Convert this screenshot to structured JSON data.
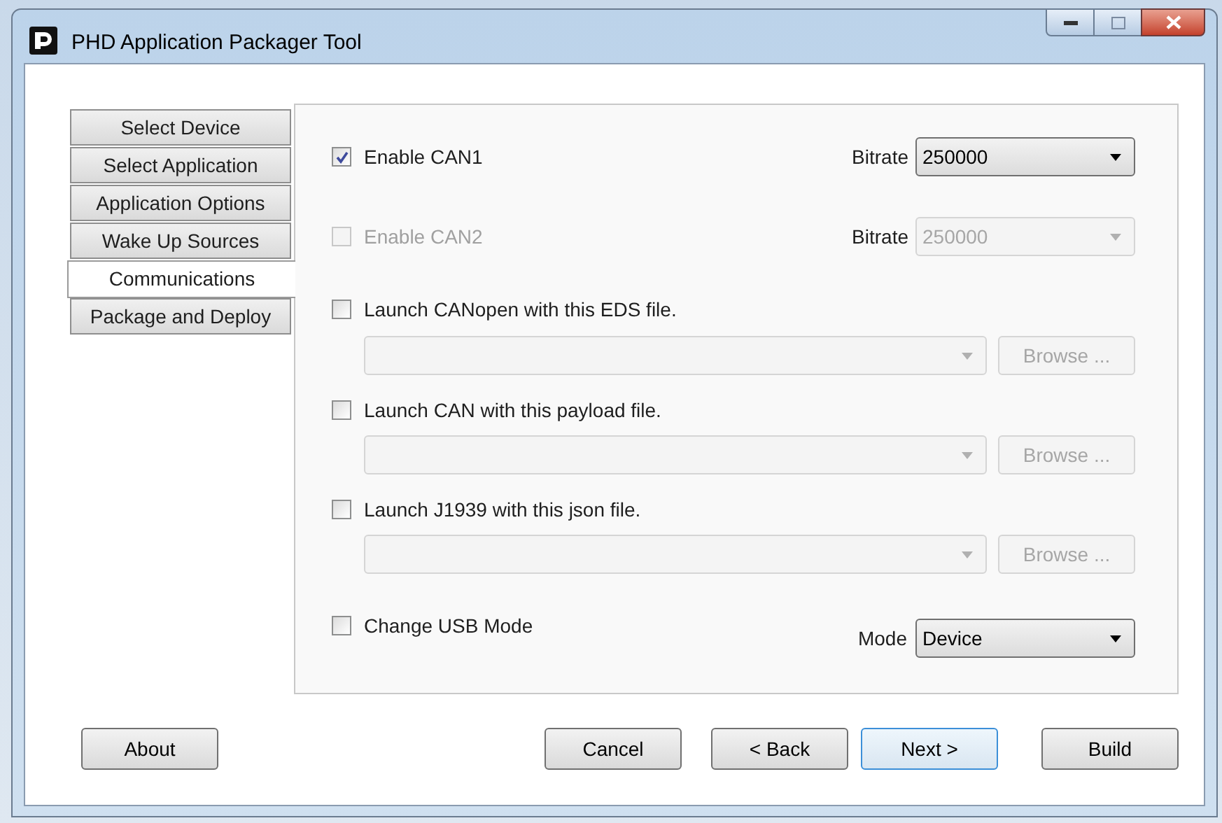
{
  "window": {
    "title": "PHD Application Packager Tool"
  },
  "tabs": [
    {
      "label": "Select Device",
      "selected": false
    },
    {
      "label": "Select Application",
      "selected": false
    },
    {
      "label": "Application Options",
      "selected": false
    },
    {
      "label": "Wake Up Sources",
      "selected": false
    },
    {
      "label": "Communications",
      "selected": true
    },
    {
      "label": "Package and Deploy",
      "selected": false
    }
  ],
  "can": [
    {
      "label": "Enable CAN1",
      "checked": true,
      "disabled": false,
      "bitrate_label": "Bitrate",
      "bitrate": "250000"
    },
    {
      "label": "Enable CAN2",
      "checked": false,
      "disabled": true,
      "bitrate_label": "Bitrate",
      "bitrate": "250000"
    }
  ],
  "files": [
    {
      "label": "Launch CANopen with this EDS file.",
      "checked": false,
      "browse": "Browse ..."
    },
    {
      "label": "Launch CAN with this payload file.",
      "checked": false,
      "browse": "Browse ..."
    },
    {
      "label": "Launch J1939 with this json file.",
      "checked": false,
      "browse": "Browse ..."
    }
  ],
  "usb": {
    "label": "Change USB Mode",
    "checked": false,
    "mode_label": "Mode",
    "mode": "Device"
  },
  "buttons": [
    {
      "label": "About",
      "focused": false
    },
    {
      "label": "Cancel",
      "focused": false
    },
    {
      "label": "< Back",
      "focused": false
    },
    {
      "label": "Next >",
      "focused": true
    },
    {
      "label": "Build",
      "focused": false
    }
  ]
}
